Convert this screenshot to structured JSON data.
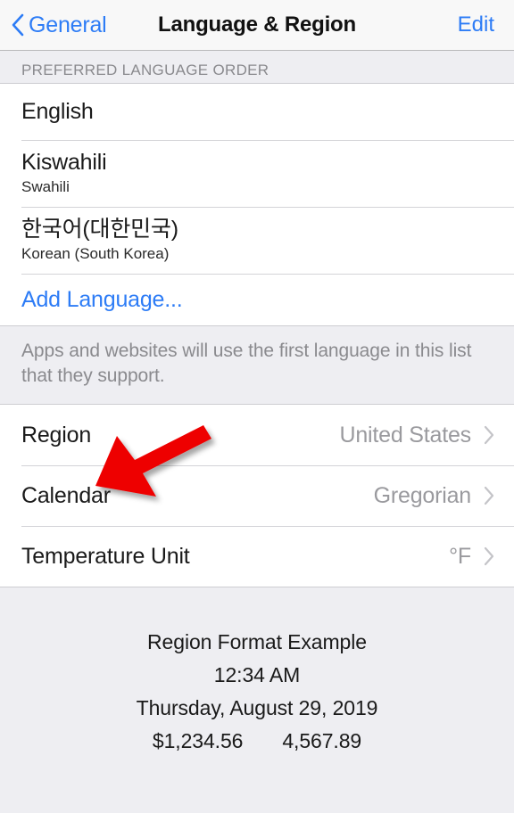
{
  "navbar": {
    "back_label": "General",
    "back_icon": "chevron-left-icon",
    "title": "Language & Region",
    "edit_label": "Edit"
  },
  "language_section": {
    "header": "PREFERRED LANGUAGE ORDER",
    "items": [
      {
        "title": "English",
        "subtitle": ""
      },
      {
        "title": "Kiswahili",
        "subtitle": "Swahili"
      },
      {
        "title": "한국어(대한민국)",
        "subtitle": "Korean (South Korea)"
      }
    ],
    "add_language_label": "Add Language...",
    "footer_note": "Apps and websites will use the first language in this list that they support."
  },
  "settings_section": {
    "rows": [
      {
        "label": "Region",
        "value": "United States",
        "accessory": "chevron-right-icon"
      },
      {
        "label": "Calendar",
        "value": "Gregorian",
        "accessory": "chevron-right-icon"
      },
      {
        "label": "Temperature Unit",
        "value": "°F",
        "accessory": "chevron-right-icon"
      }
    ]
  },
  "format_example": {
    "title": "Region Format Example",
    "time": "12:34 AM",
    "date": "Thursday, August 29, 2019",
    "currency": "$1,234.56",
    "number": "4,567.89"
  },
  "annotation": {
    "type": "arrow",
    "points_to": "Region",
    "color": "#ee0000"
  },
  "colors": {
    "accent_blue": "#2d7cf6",
    "group_background": "#eeeef2",
    "card_background": "#ffffff",
    "secondary_text": "#8a8a8e",
    "value_text": "#9a9a9e",
    "annotation_red": "#ee0000"
  }
}
